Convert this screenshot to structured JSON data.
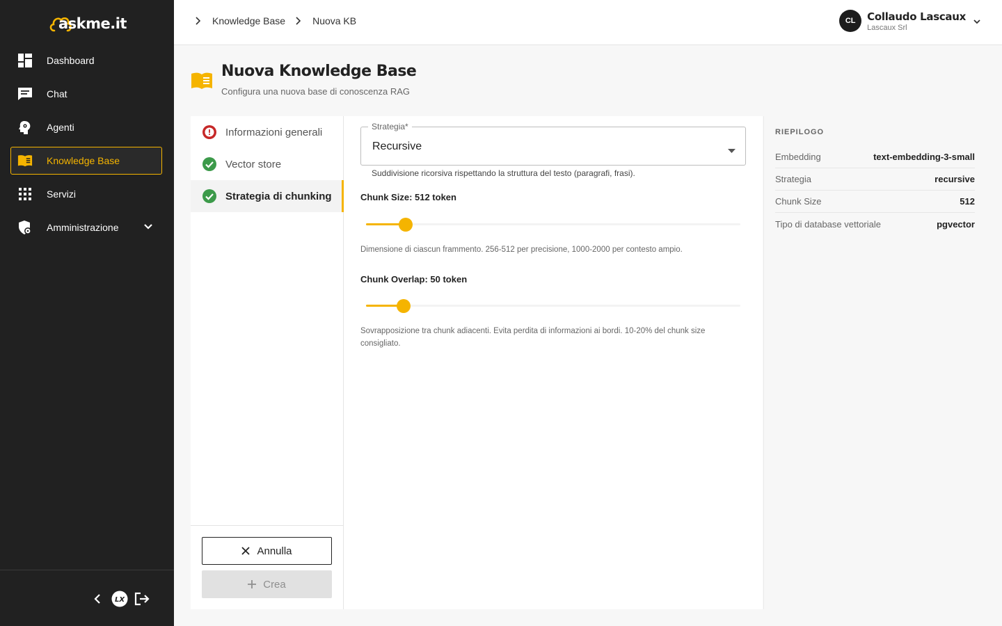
{
  "brand": {
    "name": "askme.it",
    "accent": "#f5b400"
  },
  "sidebar": {
    "items": [
      {
        "label": "Dashboard",
        "icon": "dashboard-icon"
      },
      {
        "label": "Chat",
        "icon": "chat-icon"
      },
      {
        "label": "Agenti",
        "icon": "agent-head-icon"
      },
      {
        "label": "Knowledge Base",
        "icon": "book-icon",
        "active": true
      },
      {
        "label": "Servizi",
        "icon": "grid-icon"
      },
      {
        "label": "Amministrazione",
        "icon": "admin-shield-icon",
        "expandable": true
      }
    ],
    "footer": {
      "logo_text": "LX"
    }
  },
  "breadcrumb": [
    "Knowledge Base",
    "Nuova KB"
  ],
  "user": {
    "initials": "CL",
    "name": "Collaudo Lascaux",
    "org": "Lascaux Srl"
  },
  "page": {
    "title": "Nuova Knowledge Base",
    "subtitle": "Configura una nuova base di conoscenza RAG"
  },
  "steps": [
    {
      "label": "Informazioni generali",
      "status": "error"
    },
    {
      "label": "Vector store",
      "status": "done"
    },
    {
      "label": "Strategia di chunking",
      "status": "done",
      "active": true
    }
  ],
  "actions": {
    "cancel": "Annulla",
    "create": "Crea"
  },
  "form": {
    "strategy": {
      "label": "Strategia*",
      "value": "Recursive",
      "helper": "Suddivisione ricorsiva rispettando la struttura del testo (paragrafi, frasi)."
    },
    "chunk_size": {
      "label": "Chunk Size: 512 token",
      "value": 512,
      "min": 100,
      "max": 4000,
      "description": "Dimensione di ciascun frammento. 256-512 per precisione, 1000-2000 per contesto ampio."
    },
    "chunk_overlap": {
      "label": "Chunk Overlap: 50 token",
      "value": 50,
      "min": 0,
      "max": 500,
      "description": "Sovrapposizione tra chunk adiacenti. Evita perdita di informazioni ai bordi. 10-20% del chunk size consigliato."
    }
  },
  "summary": {
    "title": "RIEPILOGO",
    "rows": [
      {
        "key": "Embedding",
        "value": "text-embedding-3-small"
      },
      {
        "key": "Strategia",
        "value": "recursive"
      },
      {
        "key": "Chunk Size",
        "value": "512"
      },
      {
        "key": "Tipo di database vettoriale",
        "value": "pgvector"
      }
    ]
  }
}
